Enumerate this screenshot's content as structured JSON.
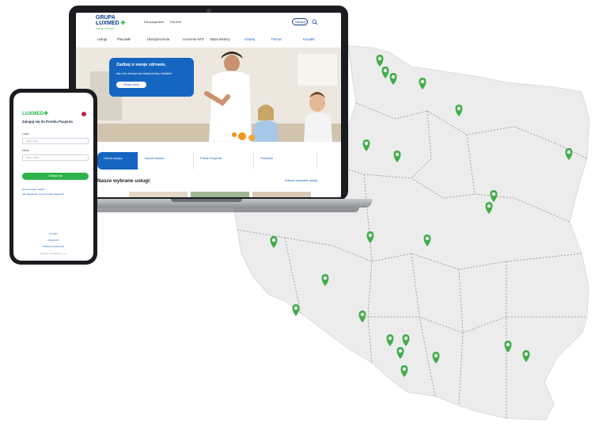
{
  "laptop_site": {
    "logo": {
      "line1": "GRUPA",
      "line2": "LUXMED",
      "cross": "✚",
      "tagline": "Zadbaj o zdrowie"
    },
    "top_links": [
      "Dla pacjentów",
      "Dla firm"
    ],
    "login_label": "Zaloguj",
    "nav": [
      "Usługi",
      "Placówki",
      "Ubezpieczenia",
      "Leczenie NFZ",
      "Baza lekarzy"
    ],
    "nav_right": [
      "Szukaj",
      "Pomoc",
      "Kontakt"
    ],
    "hero": {
      "title": "Zadbaj o swoje zdrowie,",
      "subtitle": "aby móc cieszyć się każdą chwilą z bliskimi!",
      "button": "Zobacz ofertę"
    },
    "quick_buttons": [
      "Umów wizytę",
      "Wyniki badań",
      "Portal Pacjenta",
      "Placówki"
    ],
    "services_title": "Nasze wybrane usługi:",
    "services_link": "Zobacz wszystkie usługi"
  },
  "phone": {
    "logo": "LUXMED",
    "cross": "✚",
    "title": "Zaloguj się do Portalu Pacjenta",
    "login_label": "Login",
    "login_placeholder": "Wpisz login",
    "password_label": "Hasło",
    "password_placeholder": "Wpisz hasło",
    "button": "Zaloguj się",
    "link1": "Nie pamiętasz hasła?",
    "link2": "Jak zalogować się do Portalu Pacjenta?",
    "footer": [
      "Kontakt",
      "Regulamin",
      "Polityka prywatności"
    ],
    "copyright": "Copyright LUX MED Sp. z o.o."
  },
  "colors": {
    "brand_green": "#2db34a",
    "brand_blue": "#1565c0",
    "map_land": "#ececed",
    "pin": "#3fae49"
  }
}
